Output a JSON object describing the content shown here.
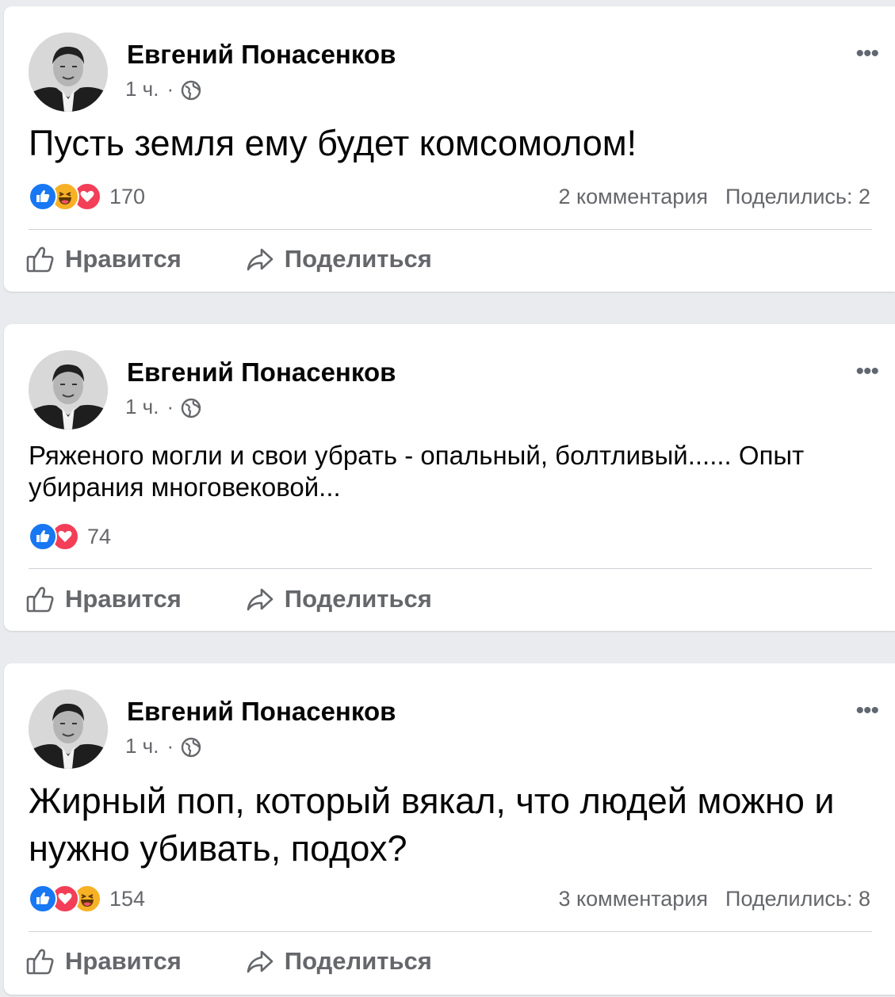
{
  "posts": [
    {
      "author": "Евгений Понасенков",
      "time": "1 ч.",
      "separator": "·",
      "text": "Пусть земля ему будет комсомолом!",
      "text_size": "big",
      "reactions": [
        "like",
        "haha",
        "love"
      ],
      "reaction_count": "170",
      "comments": "2 комментария",
      "shares": "Поделились: 2",
      "like_label": "Нравится",
      "share_label": "Поделиться"
    },
    {
      "author": "Евгений Понасенков",
      "time": "1 ч.",
      "separator": "·",
      "text": "Ряженого могли и свои убрать - опальный, болтливый...... Опыт убирания многовековой...",
      "text_size": "small",
      "reactions": [
        "like",
        "love"
      ],
      "reaction_count": "74",
      "comments": "",
      "shares": "",
      "like_label": "Нравится",
      "share_label": "Поделиться"
    },
    {
      "author": "Евгений Понасенков",
      "time": "1 ч.",
      "separator": "·",
      "text": "Жирный поп, который вякал, что людей можно и нужно убивать, подох?",
      "text_size": "big",
      "reactions": [
        "like",
        "love",
        "haha"
      ],
      "reaction_count": "154",
      "comments": "3 комментария",
      "shares": "Поделились: 8",
      "like_label": "Нравится",
      "share_label": "Поделиться"
    }
  ],
  "colors": {
    "like": "#1877f2",
    "love": "#f33e58",
    "haha": "#f7b125",
    "secondary_text": "#65676b",
    "background": "#e9ebee"
  },
  "icons": {
    "globe": "globe-icon",
    "more": "more-icon",
    "like_action": "thumbs-up-icon",
    "share_action": "share-arrow-icon"
  }
}
